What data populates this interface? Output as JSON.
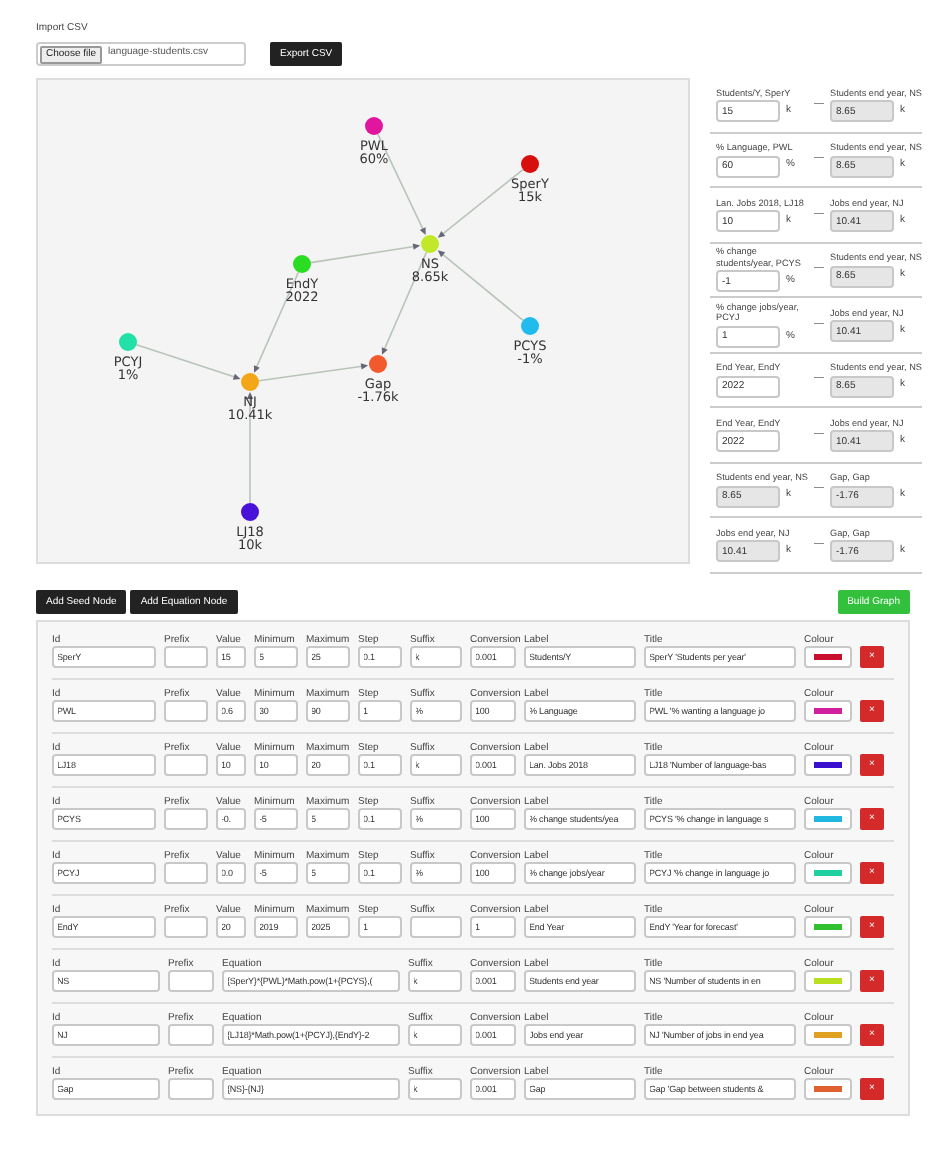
{
  "import": {
    "label": "Import CSV",
    "file_button": "Choose file",
    "file_name": "language-students.csv",
    "export_button": "Export CSV"
  },
  "graph": {
    "nodes": [
      {
        "id": "PWL",
        "value": "60%",
        "color": "#e0169e"
      },
      {
        "id": "SperY",
        "value": "15k",
        "color": "#d80e0e"
      },
      {
        "id": "NS",
        "value": "8.65k",
        "color": "#c2e82a"
      },
      {
        "id": "EndY",
        "value": "2022",
        "color": "#2add22"
      },
      {
        "id": "PCYS",
        "value": "-1%",
        "color": "#22bbee"
      },
      {
        "id": "PCYJ",
        "value": "1%",
        "color": "#22e0a8"
      },
      {
        "id": "NJ",
        "value": "10.41k",
        "color": "#f2a618"
      },
      {
        "id": "Gap",
        "value": "-1.76k",
        "color": "#f25a2e"
      },
      {
        "id": "LJ18",
        "value": "10k",
        "color": "#4a12d8"
      }
    ]
  },
  "sliders": [
    {
      "input": {
        "label": "Students/Y, SperY",
        "value": "15",
        "suffix": "k",
        "readonly": false
      },
      "link": "—",
      "output": {
        "label": "Students end year, NS",
        "value": "8.65",
        "suffix": "k"
      }
    },
    {
      "input": {
        "label": "% Language, PWL",
        "value": "60",
        "suffix": "%",
        "readonly": false
      },
      "link": "—",
      "output": {
        "label": "Students end year, NS",
        "value": "8.65",
        "suffix": "k"
      }
    },
    {
      "input": {
        "label": "Lan. Jobs 2018, LJ18",
        "value": "10",
        "suffix": "k",
        "readonly": false
      },
      "link": "—",
      "output": {
        "label": "Jobs end year, NJ",
        "value": "10.41",
        "suffix": "k"
      }
    },
    {
      "input": {
        "label": "% change students/year, PCYS",
        "value": "-1",
        "suffix": "%",
        "readonly": false
      },
      "link": "—",
      "output": {
        "label": "Students end year, NS",
        "value": "8.65",
        "suffix": "k"
      }
    },
    {
      "input": {
        "label": "% change jobs/year, PCYJ",
        "value": "1",
        "suffix": "%",
        "readonly": false
      },
      "link": "—",
      "output": {
        "label": "Jobs end year, NJ",
        "value": "10.41",
        "suffix": "k"
      }
    },
    {
      "input": {
        "label": "End Year, EndY",
        "value": "2022",
        "readonly": false
      },
      "link": "—",
      "output": {
        "label": "Students end year, NS",
        "value": "8.65",
        "suffix": "k"
      }
    },
    {
      "input": {
        "label": "End Year, EndY",
        "value": "2022",
        "readonly": false
      },
      "link": "—",
      "output": {
        "label": "Jobs end year, NJ",
        "value": "10.41",
        "suffix": "k"
      }
    },
    {
      "input": {
        "label": "Students end year, NS",
        "value": "8.65",
        "suffix": "k",
        "readonly": true
      },
      "link": "—",
      "output": {
        "label": "Gap, Gap",
        "value": "-1.76",
        "suffix": "k"
      }
    },
    {
      "input": {
        "label": "Jobs end year, NJ",
        "value": "10.41",
        "suffix": "k",
        "readonly": true
      },
      "link": "—",
      "output": {
        "label": "Gap, Gap",
        "value": "-1.76",
        "suffix": "k"
      }
    }
  ],
  "actions": {
    "add_seed": "Add Seed Node",
    "add_equation": "Add Equation Node",
    "build": "Build Graph"
  },
  "nodes_table": [
    {
      "kind": "seed",
      "fields": [
        {
          "label": "Id",
          "value": "SperY"
        },
        {
          "label": "Prefix"
        },
        {
          "label": "Value",
          "value": "15"
        },
        {
          "label": "Minimum",
          "value": "5"
        },
        {
          "label": "Maximum",
          "value": "25"
        },
        {
          "label": "Step",
          "value": "0.1"
        },
        {
          "label": "Suffix",
          "value": "k"
        },
        {
          "label": "Conversion",
          "value": "0.001"
        },
        {
          "label": "Label",
          "value": "Students/Y"
        },
        {
          "label": "Title",
          "value": "SperY 'Students per year'"
        }
      ],
      "colour": {
        "label": "Colour",
        "color": "#c8102e"
      },
      "delete": "×"
    },
    {
      "kind": "seed",
      "fields": [
        {
          "label": "Id",
          "value": "PWL"
        },
        {
          "label": "Prefix"
        },
        {
          "label": "Value",
          "value": "0.6"
        },
        {
          "label": "Minimum",
          "value": "30"
        },
        {
          "label": "Maximum",
          "value": "90"
        },
        {
          "label": "Step",
          "value": "1"
        },
        {
          "label": "Suffix",
          "value": "%"
        },
        {
          "label": "Conversion",
          "value": "100"
        },
        {
          "label": "Label",
          "value": "% Language"
        },
        {
          "label": "Title",
          "value": "PWL '% wanting a language jo"
        }
      ],
      "colour": {
        "label": "Colour",
        "color": "#d0209f"
      },
      "delete": "×"
    },
    {
      "kind": "seed",
      "fields": [
        {
          "label": "Id",
          "value": "LJ18"
        },
        {
          "label": "Prefix"
        },
        {
          "label": "Value",
          "value": "10"
        },
        {
          "label": "Minimum",
          "value": "10"
        },
        {
          "label": "Maximum",
          "value": "20"
        },
        {
          "label": "Step",
          "value": "0.1"
        },
        {
          "label": "Suffix",
          "value": "k"
        },
        {
          "label": "Conversion",
          "value": "0.001"
        },
        {
          "label": "Label",
          "value": "Lan. Jobs 2018"
        },
        {
          "label": "Title",
          "value": "LJ18 'Number of language-bas"
        }
      ],
      "colour": {
        "label": "Colour",
        "color": "#3a10d0"
      },
      "delete": "×"
    },
    {
      "kind": "seed",
      "fields": [
        {
          "label": "Id",
          "value": "PCYS"
        },
        {
          "label": "Prefix"
        },
        {
          "label": "Value",
          "value": "-0."
        },
        {
          "label": "Minimum",
          "value": "-5"
        },
        {
          "label": "Maximum",
          "value": "5"
        },
        {
          "label": "Step",
          "value": "0.1"
        },
        {
          "label": "Suffix",
          "value": "%"
        },
        {
          "label": "Conversion",
          "value": "100"
        },
        {
          "label": "Label",
          "value": "% change students/yea"
        },
        {
          "label": "Title",
          "value": "PCYS '% change in language s"
        }
      ],
      "colour": {
        "label": "Colour",
        "color": "#20b8e0"
      },
      "delete": "×"
    },
    {
      "kind": "seed",
      "fields": [
        {
          "label": "Id",
          "value": "PCYJ"
        },
        {
          "label": "Prefix"
        },
        {
          "label": "Value",
          "value": "0.0"
        },
        {
          "label": "Minimum",
          "value": "-5"
        },
        {
          "label": "Maximum",
          "value": "5"
        },
        {
          "label": "Step",
          "value": "0.1"
        },
        {
          "label": "Suffix",
          "value": "%"
        },
        {
          "label": "Conversion",
          "value": "100"
        },
        {
          "label": "Label",
          "value": "% change jobs/year"
        },
        {
          "label": "Title",
          "value": "PCYJ '% change in language jo"
        }
      ],
      "colour": {
        "label": "Colour",
        "color": "#20d0a0"
      },
      "delete": "×"
    },
    {
      "kind": "seed",
      "fields": [
        {
          "label": "Id",
          "value": "EndY"
        },
        {
          "label": "Prefix"
        },
        {
          "label": "Value",
          "value": "20"
        },
        {
          "label": "Minimum",
          "value": "2019"
        },
        {
          "label": "Maximum",
          "value": "2025"
        },
        {
          "label": "Step",
          "value": "1"
        },
        {
          "label": "Suffix"
        },
        {
          "label": "Conversion",
          "value": "1"
        },
        {
          "label": "Label",
          "value": "End Year"
        },
        {
          "label": "Title",
          "value": "EndY 'Year for forecast'"
        }
      ],
      "colour": {
        "label": "Colour",
        "color": "#30c030"
      },
      "delete": "×"
    },
    {
      "kind": "equation",
      "fields": [
        {
          "label": "Id",
          "value": "NS"
        },
        {
          "label": "Prefix"
        },
        {
          "label": "Equation",
          "value": "{SperY}*{PWL}*Math.pow(1+{PCYS},("
        },
        {
          "label": "Suffix",
          "value": "k"
        },
        {
          "label": "Conversion",
          "value": "0.001"
        },
        {
          "label": "Label",
          "value": "Students end year"
        },
        {
          "label": "Title",
          "value": "NS 'Number of students in en"
        }
      ],
      "colour": {
        "label": "Colour",
        "color": "#b8e020"
      },
      "delete": "×"
    },
    {
      "kind": "equation",
      "fields": [
        {
          "label": "Id",
          "value": "NJ"
        },
        {
          "label": "Prefix"
        },
        {
          "label": "Equation",
          "value": "{LJ18}*Math.pow(1+{PCYJ},{EndY}-2"
        },
        {
          "label": "Suffix",
          "value": "k"
        },
        {
          "label": "Conversion",
          "value": "0.001"
        },
        {
          "label": "Label",
          "value": "Jobs end year"
        },
        {
          "label": "Title",
          "value": "NJ 'Number of jobs in end yea"
        }
      ],
      "colour": {
        "label": "Colour",
        "color": "#e0a020"
      },
      "delete": "×"
    },
    {
      "kind": "equation",
      "fields": [
        {
          "label": "Id",
          "value": "Gap"
        },
        {
          "label": "Prefix"
        },
        {
          "label": "Equation",
          "value": "{NS}-{NJ}"
        },
        {
          "label": "Suffix",
          "value": "k"
        },
        {
          "label": "Conversion",
          "value": "0.001"
        },
        {
          "label": "Label",
          "value": "Gap"
        },
        {
          "label": "Title",
          "value": "Gap 'Gap between students &"
        }
      ],
      "colour": {
        "label": "Colour",
        "color": "#e06030"
      },
      "delete": "×"
    }
  ]
}
